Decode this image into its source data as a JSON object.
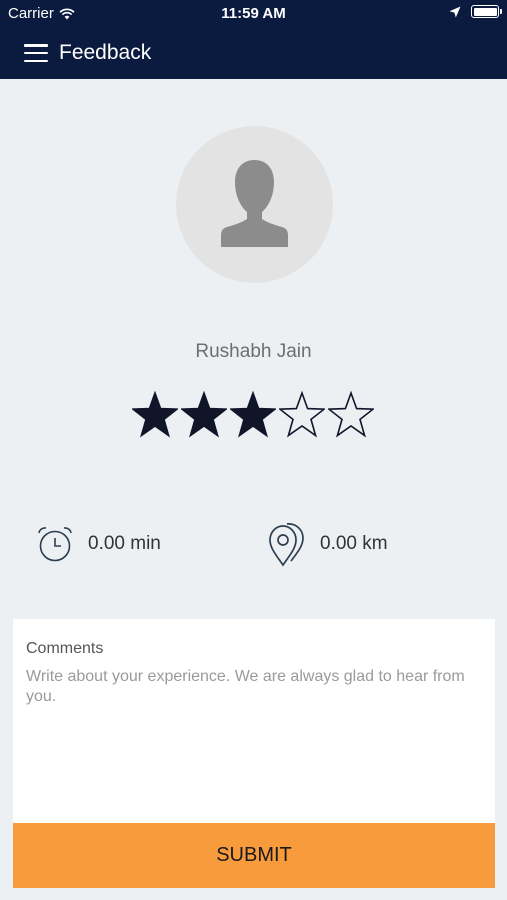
{
  "status_bar": {
    "carrier": "Carrier",
    "time": "11:59 AM",
    "icons": [
      "wifi-icon",
      "location-arrow-icon",
      "battery-icon"
    ]
  },
  "nav": {
    "title": "Feedback",
    "menu_icon": "hamburger-menu-icon"
  },
  "profile": {
    "name": "Rushabh Jain",
    "avatar_icon": "person-silhouette-icon"
  },
  "rating": {
    "value": 3,
    "max": 5
  },
  "stats": {
    "time": {
      "icon": "alarm-clock-icon",
      "value": "0.00 min"
    },
    "distance": {
      "icon": "map-pin-icon",
      "value": "0.00 km"
    }
  },
  "comments": {
    "label": "Comments",
    "placeholder": "Write about your experience. We are always glad to hear from you.",
    "value": ""
  },
  "submit": {
    "label": "SUBMIT"
  },
  "colors": {
    "nav_background": "#0b1a3f",
    "page_background": "#ecf0f3",
    "submit_background": "#f79b3c",
    "star_filled": "#11152a"
  }
}
